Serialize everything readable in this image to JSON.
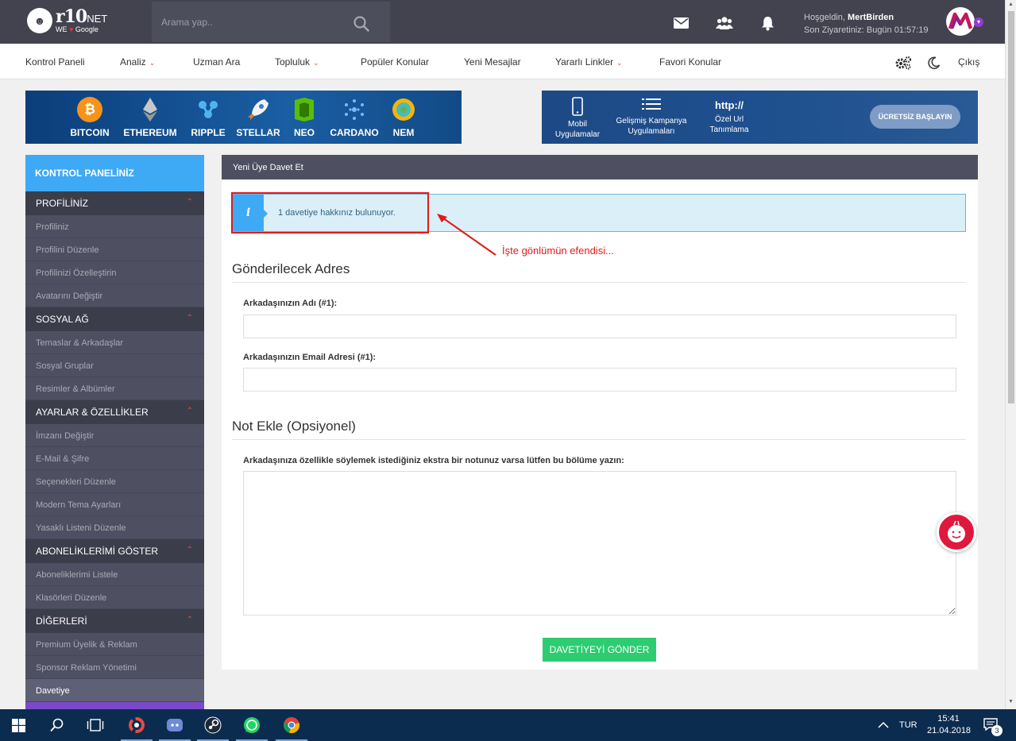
{
  "header": {
    "logo_main": "r10",
    "logo_net": "NET",
    "logo_we": "WE",
    "logo_google": "Google",
    "search_placeholder": "Arama yap..",
    "welcome_prefix": "Hoşgeldin,",
    "username": "MertBirden",
    "last_visit": "Son Ziyaretiniz: Bugün 01:57:19"
  },
  "nav": {
    "items": [
      {
        "label": "Kontrol Paneli",
        "dropdown": false
      },
      {
        "label": "Analiz",
        "dropdown": true
      },
      {
        "label": "Uzman Ara",
        "dropdown": false
      },
      {
        "label": "Topluluk",
        "dropdown": true
      },
      {
        "label": "Popüler Konular",
        "dropdown": false
      },
      {
        "label": "Yeni Mesajlar",
        "dropdown": false
      },
      {
        "label": "Yararlı Linkler",
        "dropdown": true
      },
      {
        "label": "Favori Konular",
        "dropdown": false
      }
    ],
    "logout": "Çıkış"
  },
  "banner_crypto": {
    "coins": [
      "BITCOIN",
      "ETHEREUM",
      "RIPPLE",
      "STELLAR",
      "NEO",
      "CARDANO",
      "NEM"
    ]
  },
  "banner_features": {
    "feature1": "Mobil Uygulamalar",
    "feature2": "Gelişmiş Kampanya Uygulamaları",
    "feature3_top": "http://",
    "feature3": "Özel Url Tanımlama",
    "button": "ÜCRETSİZ BAŞLAYIN"
  },
  "sidebar": {
    "title": "KONTROL PANELİNİZ",
    "sections": [
      {
        "title": "PROFİLİNİZ",
        "items": [
          "Profiliniz",
          "Profilini Düzenle",
          "Profilinizi Özelleştirin",
          "Avatarını Değiştir"
        ]
      },
      {
        "title": "SOSYAL AĞ",
        "items": [
          "Temaslar & Arkadaşlar",
          "Sosyal Gruplar",
          "Resimler & Albümler"
        ]
      },
      {
        "title": "AYARLAR & ÖZELLİKLER",
        "items": [
          "İmzanı Değiştir",
          "E-Mail & Şifre",
          "Seçenekleri Düzenle",
          "Modern Tema Ayarları",
          "Yasaklı Listeni Düzenle"
        ]
      },
      {
        "title": "ABONELİKLERİMİ GÖSTER",
        "items": [
          "Aboneliklerimi Listele",
          "Klasörleri Düzenle"
        ]
      },
      {
        "title": "DİĞERLERİ",
        "items": [
          "Premium Üyelik & Reklam",
          "Sponsor Reklam Yönetimi",
          "Davetiye"
        ]
      }
    ]
  },
  "main": {
    "panel_title": "Yeni Üye Davet Et",
    "alert_icon": "i",
    "alert_text": "1 davetiye hakkınız bulunuyor.",
    "annotation": "İşte gönlümün efendisi...",
    "section1_title": "Gönderilecek Adres",
    "name_label": "Arkadaşınızın Adı (#1):",
    "name_value": "",
    "email_label": "Arkadaşınızın Email Adresi (#1):",
    "email_value": "",
    "section2_title": "Not Ekle (Opsiyonel)",
    "note_label": "Arkadaşınıza özellikle söylemek istediğiniz ekstra bir notunuz varsa lütfen bu bölüme yazın:",
    "note_value": "",
    "submit": "DAVETİYEYİ GÖNDER"
  },
  "taskbar": {
    "lang": "TUR",
    "time": "15:41",
    "date": "21.04.2018",
    "notifications": "3"
  },
  "colors": {
    "header_bg": "#42434f",
    "sidebar_bg": "#4e5062",
    "accent_blue": "#3ea9f5",
    "submit_green": "#2ecc71",
    "annotation_red": "#e01b1b"
  }
}
